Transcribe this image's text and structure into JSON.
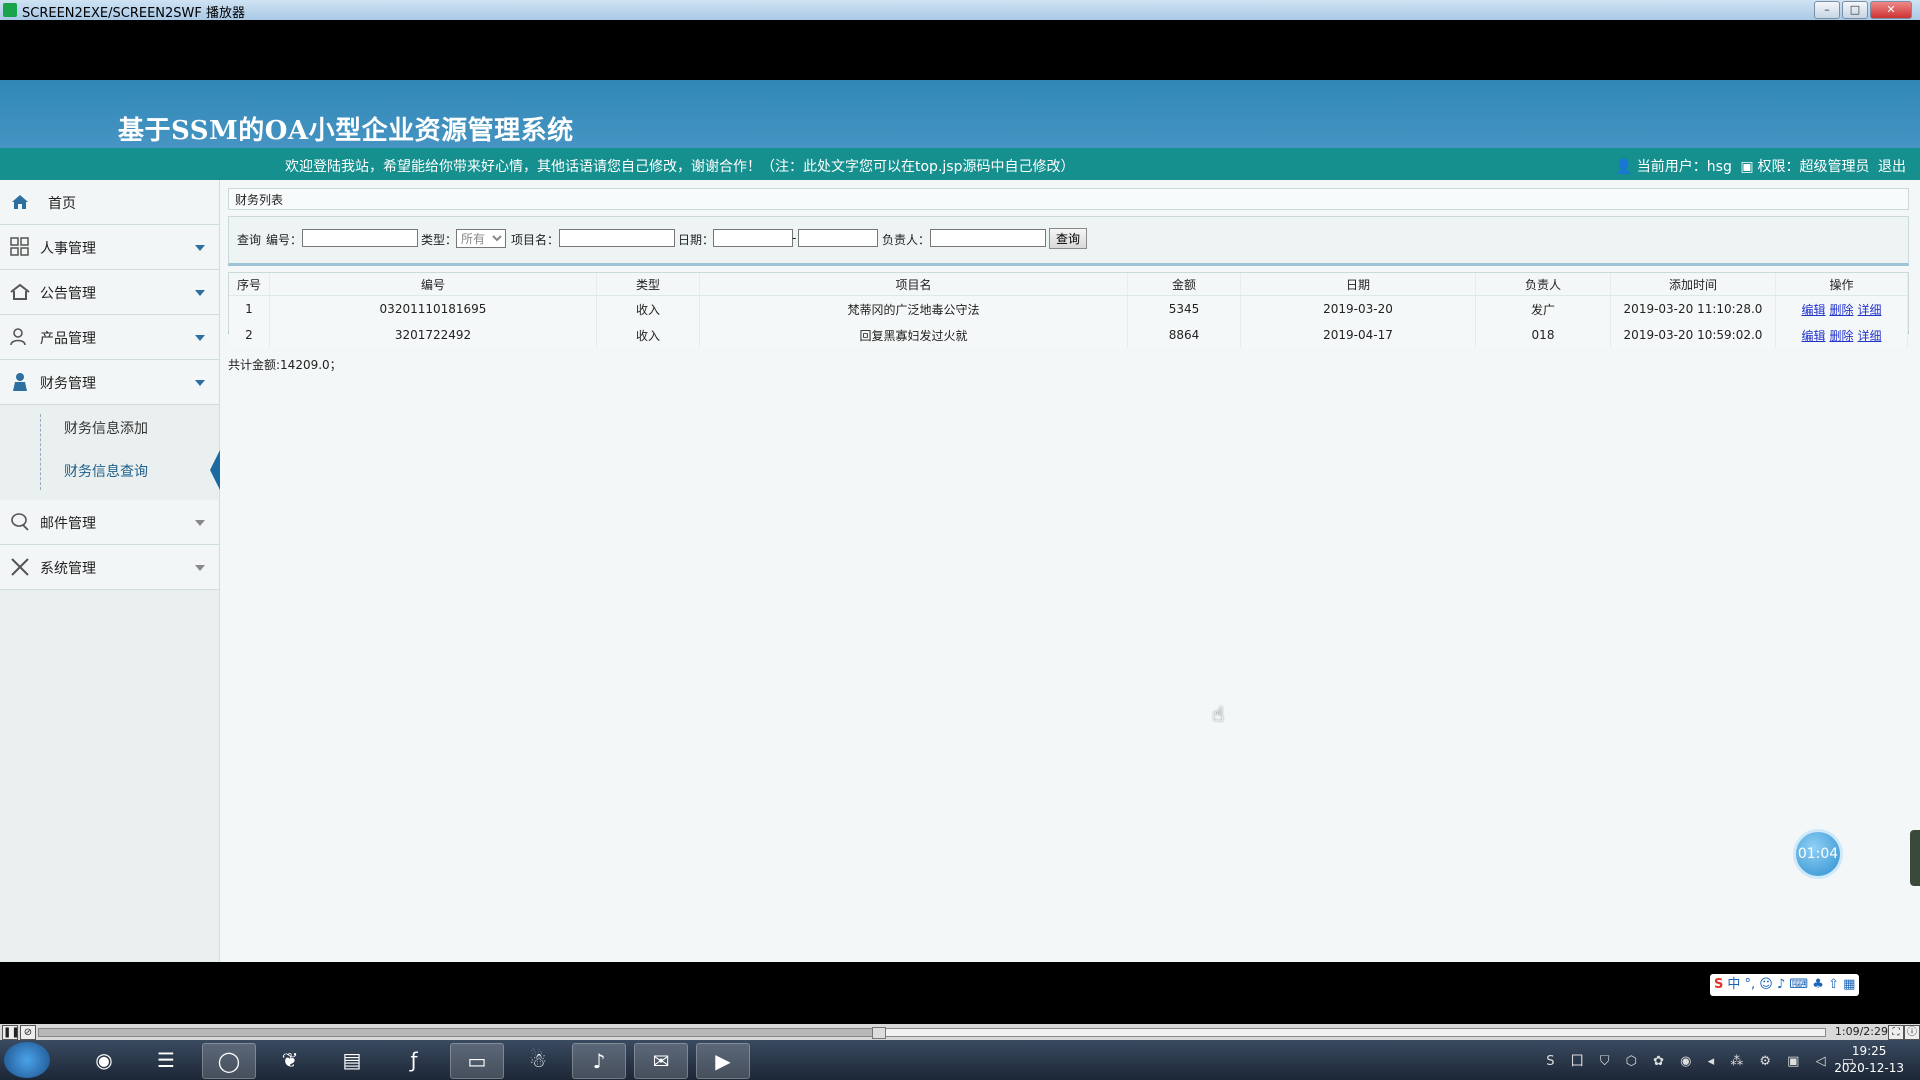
{
  "window": {
    "title": "SCREEN2EXE/SCREEN2SWF 播放器",
    "min": "–",
    "max": "□",
    "close": "✕"
  },
  "site": {
    "title": "基于SSM的OA小型企业资源管理系统",
    "welcome": "欢迎登陆我站，希望能给你带来好心情，其他话语请您自己修改，谢谢合作！（注：此处文字您可以在top.jsp源码中自己修改）",
    "current_user_label": "当前用户：hsg",
    "permission_label": "权限：超级管理员",
    "logout": "退出"
  },
  "sidebar": {
    "items": [
      {
        "label": "首页",
        "icon": "home-icon"
      },
      {
        "label": "人事管理",
        "icon": "grid-icon"
      },
      {
        "label": "公告管理",
        "icon": "house-icon"
      },
      {
        "label": "产品管理",
        "icon": "users-icon"
      },
      {
        "label": "财务管理",
        "icon": "person-icon"
      },
      {
        "label": "邮件管理",
        "icon": "chat-icon"
      },
      {
        "label": "系统管理",
        "icon": "tools-icon"
      }
    ],
    "sub_items": [
      {
        "label": "财务信息添加"
      },
      {
        "label": "财务信息查询"
      }
    ]
  },
  "panel": {
    "title": "财务列表"
  },
  "search": {
    "query_label": "查询",
    "code_label": "编号：",
    "type_label": "类型：",
    "type_value": "所有",
    "project_label": "项目名：",
    "date_label": "日期：",
    "date_sep": "-",
    "owner_label": "负责人：",
    "button": "查询"
  },
  "table": {
    "headers": [
      "序号",
      "编号",
      "类型",
      "项目名",
      "金额",
      "日期",
      "负责人",
      "添加时间",
      "操作"
    ],
    "rows": [
      {
        "seq": "1",
        "code": "03201110181695",
        "type": "收入",
        "project": "梵蒂冈的广泛地毒公守法",
        "amount": "5345",
        "date": "2019-03-20",
        "owner": "发广",
        "added": "2019-03-20 11:10:28.0"
      },
      {
        "seq": "2",
        "code": "3201722492",
        "type": "收入",
        "project": "回复黑寡妇发过火就",
        "amount": "8864",
        "date": "2019-04-17",
        "owner": "018",
        "added": "2019-03-20 10:59:02.0"
      }
    ],
    "actions": {
      "edit": "编辑",
      "delete": "删除",
      "detail": "详细"
    }
  },
  "total": "共计金额:14209.0；",
  "timer": "01:04",
  "ime": {
    "label": "中 °, ☺ ♪ ⌨ ♣ ⇧ ▦"
  },
  "player": {
    "time": "1:09/2:29",
    "progress": 0.47
  },
  "taskbar": {
    "apps": [
      "chrome-icon",
      "terminal-icon",
      "browser-icon",
      "leaf-icon",
      "notepad-icon",
      "flash-icon",
      "folder-icon",
      "qq-icon",
      "audio-icon",
      "wechat-icon",
      "player-icon"
    ],
    "tray": "S 囗 ⛉ ⬡ ✿ ◉ ◂ ⁂ ⚙ ▣ ◁ ▭",
    "time": "19:25",
    "date": "2020-12-13"
  }
}
